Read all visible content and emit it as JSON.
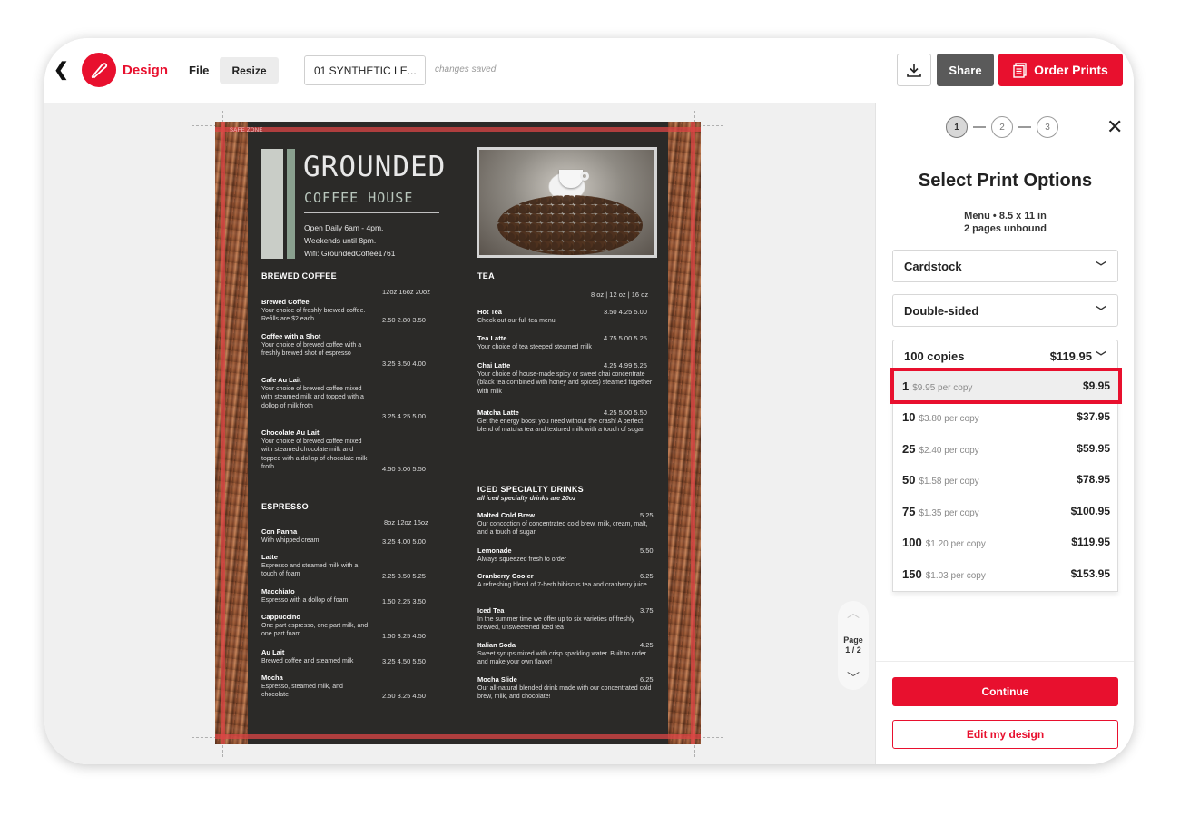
{
  "topbar": {
    "app_label": "Design",
    "file_label": "File",
    "resize_label": "Resize",
    "doc_name": "01 SYNTHETIC LE...",
    "save_status": "changes saved",
    "share_label": "Share",
    "order_label": "Order Prints",
    "brand_color": "#e8102e"
  },
  "menu": {
    "safe_zone": "SAFE ZONE",
    "brand": {
      "title": "GROUNDED",
      "subtitle": "COFFEE HOUSE",
      "info1": "Open Daily 6am - 4pm.",
      "info2": "Weekends until 8pm.",
      "info3": "Wifi: GroundedCoffee1761"
    },
    "brewed": {
      "title": "BREWED COFFEE",
      "sizes": "12oz  16oz  20oz",
      "items": [
        {
          "name": "Brewed Coffee",
          "desc": "Your choice of freshly brewed coffee. Refills are $2 each",
          "price": "2.50  2.80  3.50"
        },
        {
          "name": "Coffee with a Shot",
          "desc": "Your choice of brewed coffee with a freshly brewed shot of espresso",
          "price": "3.25  3.50  4.00"
        },
        {
          "name": "Cafe Au Lait",
          "desc": "Your choice of brewed coffee mixed with steamed milk and topped with a dollop of milk froth",
          "price": "3.25  4.25  5.00"
        },
        {
          "name": "Chocolate Au Lait",
          "desc": "Your choice of brewed coffee mixed with steamed chocolate milk and topped with a dollop of chocolate milk froth",
          "price": "4.50  5.00  5.50"
        }
      ]
    },
    "espresso": {
      "title": "ESPRESSO",
      "sizes": "8oz  12oz  16oz",
      "items": [
        {
          "name": "Con Panna",
          "desc": "With whipped cream",
          "price": "3.25  4.00  5.00"
        },
        {
          "name": "Latte",
          "desc": "Espresso and steamed milk with a touch of foam",
          "price": "2.25  3.50  5.25"
        },
        {
          "name": "Macchiato",
          "desc": "Espresso with a dollop of foam",
          "price": "1.50  2.25  3.50"
        },
        {
          "name": "Cappuccino",
          "desc": "One part espresso, one part milk, and one part foam",
          "price": "1.50  3.25  4.50"
        },
        {
          "name": "Au Lait",
          "desc": "Brewed coffee and steamed milk",
          "price": "3.25  4.50  5.50"
        },
        {
          "name": "Mocha",
          "desc": "Espresso, steamed milk, and chocolate",
          "price": "2.50  3.25  4.50"
        }
      ]
    },
    "tea": {
      "title": "TEA",
      "sizes": "8 oz  |  12 oz  |  16 oz",
      "items": [
        {
          "name": "Hot Tea",
          "desc": "Check out our full tea menu",
          "price": "3.50  4.25  5.00"
        },
        {
          "name": "Tea Latte",
          "desc": "Your choice of tea steeped steamed milk",
          "price": "4.75  5.00  5.25"
        },
        {
          "name": "Chai Latte",
          "desc": "Your choice of house-made spicy or sweet chai concentrate (black tea combined with honey and spices) steamed together with milk",
          "price": "4.25  4.99  5.25"
        },
        {
          "name": "Matcha Latte",
          "desc": "Get the energy boost you need without the crash! A perfect blend of matcha tea and textured milk with a touch of sugar",
          "price": "4.25  5.00  5.50"
        }
      ]
    },
    "iced": {
      "title": "ICED SPECIALTY DRINKS",
      "note": "all iced specialty drinks are 20oz",
      "items": [
        {
          "name": "Malted Cold Brew",
          "desc": "Our concoction of concentrated cold brew, milk, cream, malt, and a touch of sugar",
          "price": "5.25"
        },
        {
          "name": "Lemonade",
          "desc": "Always squeezed fresh to order",
          "price": "5.50"
        },
        {
          "name": "Cranberry Cooler",
          "desc": "A refreshing blend of 7-herb hibiscus tea and cranberry juice",
          "price": "6.25"
        },
        {
          "name": "Iced Tea",
          "desc": "In the summer time we offer up to six varieties of freshly brewed, unsweetened iced tea",
          "price": "3.75"
        },
        {
          "name": "Italian Soda",
          "desc": "Sweet syrups mixed with crisp sparkling water. Built to order and make your own flavor!",
          "price": "4.25"
        },
        {
          "name": "Mocha Slide",
          "desc": "Our all-natural blended drink made with our concentrated cold brew, milk, and chocolate!",
          "price": "6.25"
        }
      ]
    }
  },
  "pager": {
    "label": "Page",
    "value": "1 / 2"
  },
  "panel": {
    "steps": [
      "1",
      "2",
      "3"
    ],
    "active_step": 1,
    "title": "Select Print Options",
    "sub1": "Menu • 8.5 x 11 in",
    "sub2": "2 pages unbound",
    "paper": "Cardstock",
    "sides": "Double-sided",
    "qty_label": "100 copies",
    "qty_price": "$119.95",
    "quantities": [
      {
        "qty": "1",
        "per": "$9.95 per copy",
        "total": "$9.95"
      },
      {
        "qty": "10",
        "per": "$3.80 per copy",
        "total": "$37.95"
      },
      {
        "qty": "25",
        "per": "$2.40 per copy",
        "total": "$59.95"
      },
      {
        "qty": "50",
        "per": "$1.58 per copy",
        "total": "$78.95"
      },
      {
        "qty": "75",
        "per": "$1.35 per copy",
        "total": "$100.95"
      },
      {
        "qty": "100",
        "per": "$1.20 per copy",
        "total": "$119.95"
      },
      {
        "qty": "150",
        "per": "$1.03 per copy",
        "total": "$153.95"
      }
    ],
    "continue_label": "Continue",
    "edit_label": "Edit my design"
  }
}
